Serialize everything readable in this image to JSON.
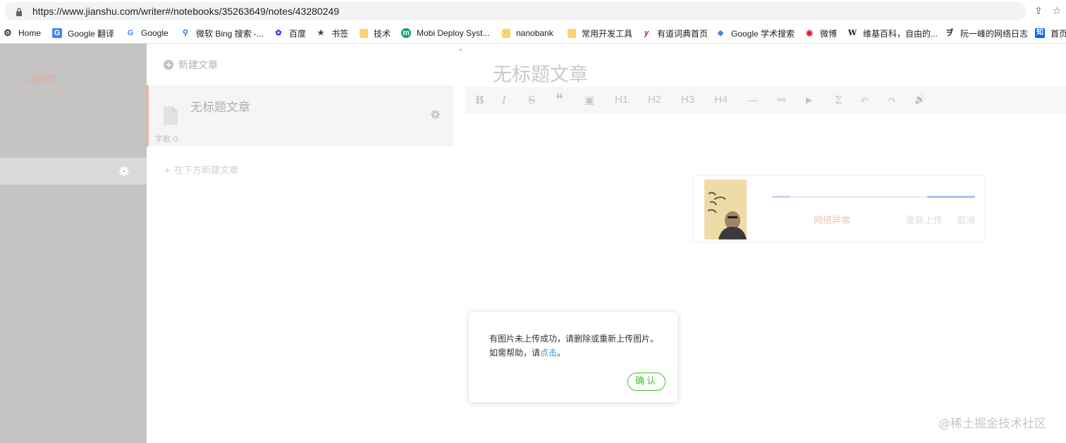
{
  "browser": {
    "url": "https://www.jianshu.com/writer#/notebooks/35263649/notes/43280249",
    "bookmarks": [
      {
        "label": "Home",
        "icon": "home-icon"
      },
      {
        "label": "Google 翻译",
        "icon": "google-translate-icon"
      },
      {
        "label": "Google",
        "icon": "google-icon"
      },
      {
        "label": "微软 Bing 搜索 -...",
        "icon": "bing-icon"
      },
      {
        "label": "百度",
        "icon": "baidu-icon"
      },
      {
        "label": "书签",
        "icon": "star-icon"
      },
      {
        "label": "技术",
        "icon": "folder-icon"
      },
      {
        "label": "Mobi Deploy Syst...",
        "icon": "mobi-icon"
      },
      {
        "label": "nanobank",
        "icon": "folder-icon"
      },
      {
        "label": "常用开发工具",
        "icon": "folder-icon"
      },
      {
        "label": "有道词典首页",
        "icon": "youdao-icon"
      },
      {
        "label": "Google 学术搜索",
        "icon": "scholar-icon"
      },
      {
        "label": "微博",
        "icon": "weibo-icon"
      },
      {
        "label": "维基百科，自由的...",
        "icon": "wikipedia-icon"
      },
      {
        "label": "阮一峰的网络日志",
        "icon": "ruanyifeng-icon"
      },
      {
        "label": "首页",
        "icon": "zhihu-icon"
      }
    ]
  },
  "sidebar": {
    "back_label": "回首页"
  },
  "notes": {
    "new_article": "新建文章",
    "item_title": "无标题文章",
    "item_count": "字数:0",
    "add_below": "在下方新建文章"
  },
  "editor": {
    "title": "无标题文章",
    "toolbar": [
      "B",
      "I",
      "S",
      "❝",
      "▣",
      "H1",
      "H2",
      "H3",
      "H4",
      "—",
      "⚯",
      "▶",
      "Σ",
      "↶",
      "↷",
      "🔊"
    ],
    "upload": {
      "progress": 0.2,
      "status": "网络异常",
      "reupload": "重新上传",
      "cancel": "取消"
    }
  },
  "dialog": {
    "text_before": "有图片未上传成功，请删除或重新上传图片。如需帮助，请",
    "link": "点击",
    "text_after": "。",
    "ok": "确认"
  },
  "watermark": "@稀土掘金技术社区",
  "colors": {
    "sidebar_bg": "#c4c4c4",
    "accent_salmon": "#f2b5a4",
    "confirm_green": "#42c02e",
    "link_blue": "#3194d0"
  }
}
